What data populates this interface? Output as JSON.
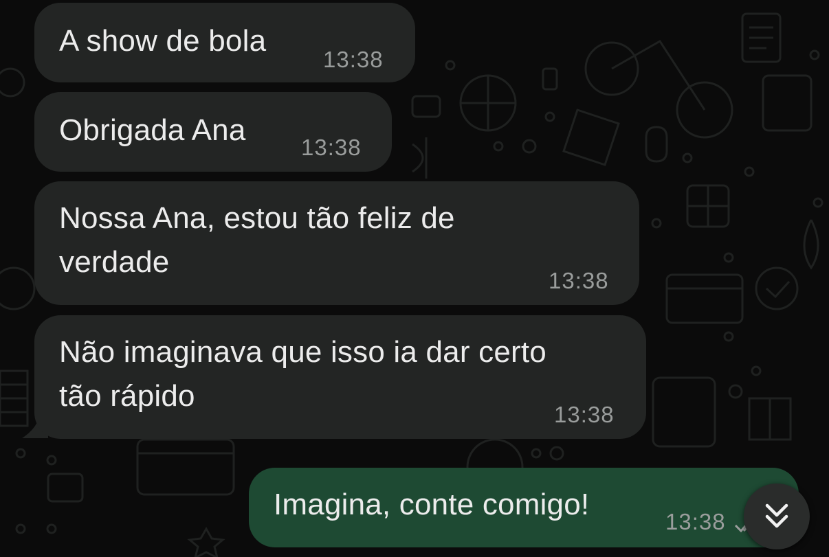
{
  "chat": {
    "messages": [
      {
        "direction": "incoming",
        "text": "A show de bola",
        "time": "13:38"
      },
      {
        "direction": "incoming",
        "text": "Obrigada Ana",
        "time": "13:38"
      },
      {
        "direction": "incoming",
        "text": "Nossa Ana, estou tão feliz de\nverdade",
        "time": "13:38"
      },
      {
        "direction": "incoming",
        "text": "Não imaginava que isso ia dar certo\ntão rápido",
        "time": "13:38"
      },
      {
        "direction": "outgoing",
        "text": "Imagina, conte comigo!",
        "time": "13:38"
      }
    ]
  },
  "icons": {
    "scroll_down": "double-chevron-down-icon",
    "read_receipt": "double-check-icon"
  },
  "colors": {
    "background": "#0b0b0b",
    "incoming_bubble": "#232524",
    "outgoing_bubble": "#1e4a33",
    "timestamp": "#9a9d9c"
  }
}
